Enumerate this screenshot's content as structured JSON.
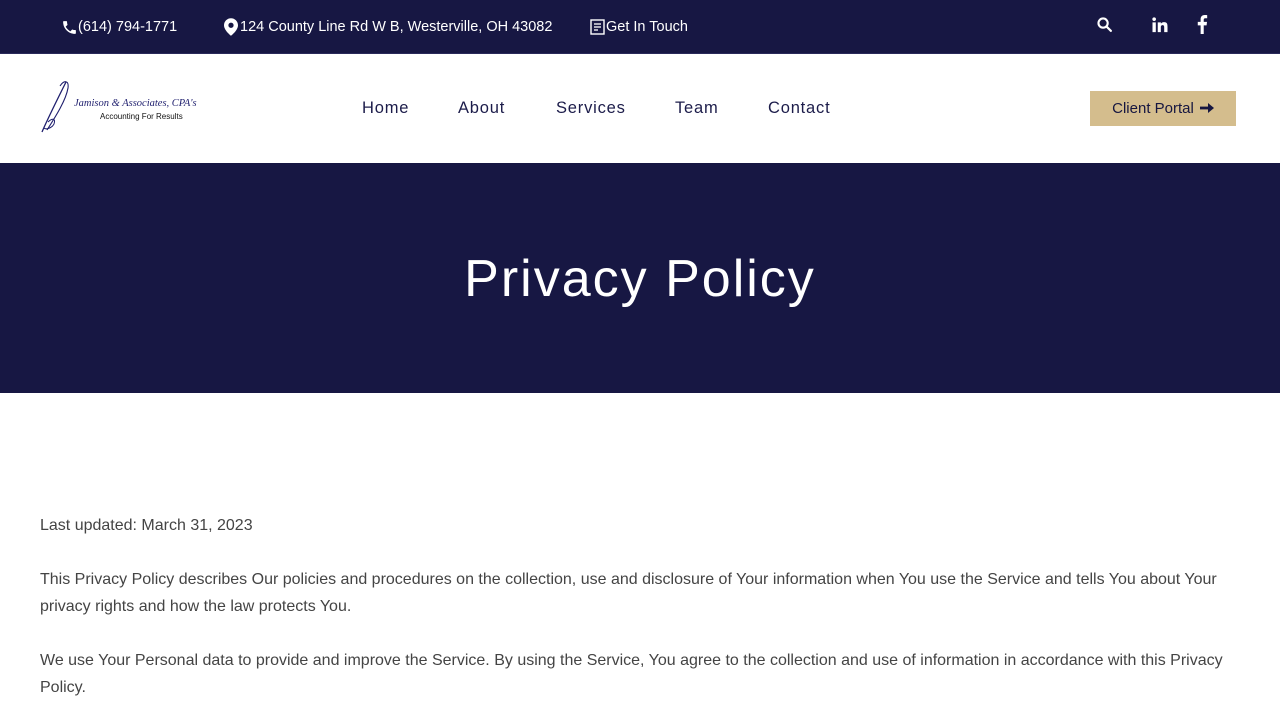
{
  "topbar": {
    "phone": "(614) 794-1771",
    "address": "124 County Line Rd W B, Westerville, OH 43082",
    "contact_link": "Get In Touch",
    "icons": [
      "phone-icon",
      "map-pin-icon",
      "contact-form-icon",
      "search-icon",
      "linkedin-icon",
      "facebook-icon"
    ]
  },
  "header": {
    "logo": {
      "name": "Jamison & Associates, CPA's",
      "tagline": "Accounting For Results"
    },
    "nav": [
      "Home",
      "About",
      "Services",
      "Team",
      "Contact"
    ],
    "portal_button": "Client Portal"
  },
  "hero": {
    "title": "Privacy Policy"
  },
  "content": {
    "last_updated": "Last updated: March 31, 2023",
    "paragraphs": [
      "This Privacy Policy describes Our policies and procedures on the collection, use and disclosure of Your information when You use the Service and tells You about Your privacy rights and how the law protects You.",
      "We use Your Personal data to provide and improve the Service. By using the Service, You agree to the collection and use of information in accordance with this Privacy Policy."
    ]
  },
  "colors": {
    "navy": "#171743",
    "gold": "#d4bd8d",
    "text": "#444444"
  }
}
